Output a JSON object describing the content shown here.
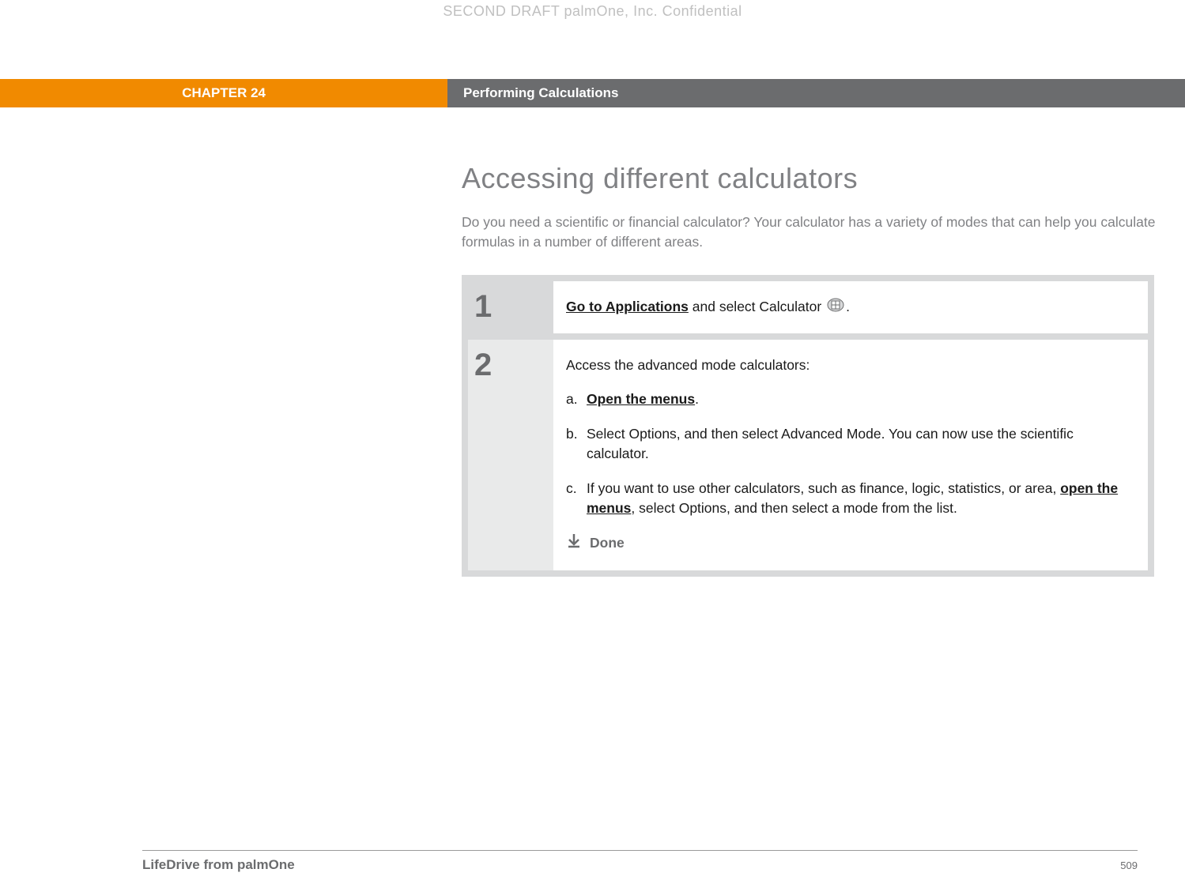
{
  "watermark": "SECOND DRAFT palmOne, Inc.  Confidential",
  "header": {
    "chapter": "CHAPTER 24",
    "title": "Performing Calculations"
  },
  "section": {
    "heading": "Accessing different calculators",
    "intro": "Do you need a scientific or financial calculator? Your calculator has a variety of modes that can help you calculate formulas in a number of different areas."
  },
  "steps": [
    {
      "number": "1",
      "link": "Go to Applications",
      "rest": " and select Calculator ",
      "trailing_period": "."
    },
    {
      "number": "2",
      "lead": "Access the advanced mode calculators:",
      "subs": [
        {
          "marker": "a.",
          "bold_link": "Open the menus",
          "after": "."
        },
        {
          "marker": "b.",
          "text": "Select Options, and then select Advanced Mode. You can now use the scientific calculator."
        },
        {
          "marker": "c.",
          "pre": "If you want to use other calculators, such as finance, logic, statistics, or area, ",
          "bold_link": "open the menus",
          "after": ", select Options, and then select a mode from the list."
        }
      ],
      "done": "Done"
    }
  ],
  "footer": {
    "product": "LifeDrive from palmOne",
    "page": "509"
  }
}
